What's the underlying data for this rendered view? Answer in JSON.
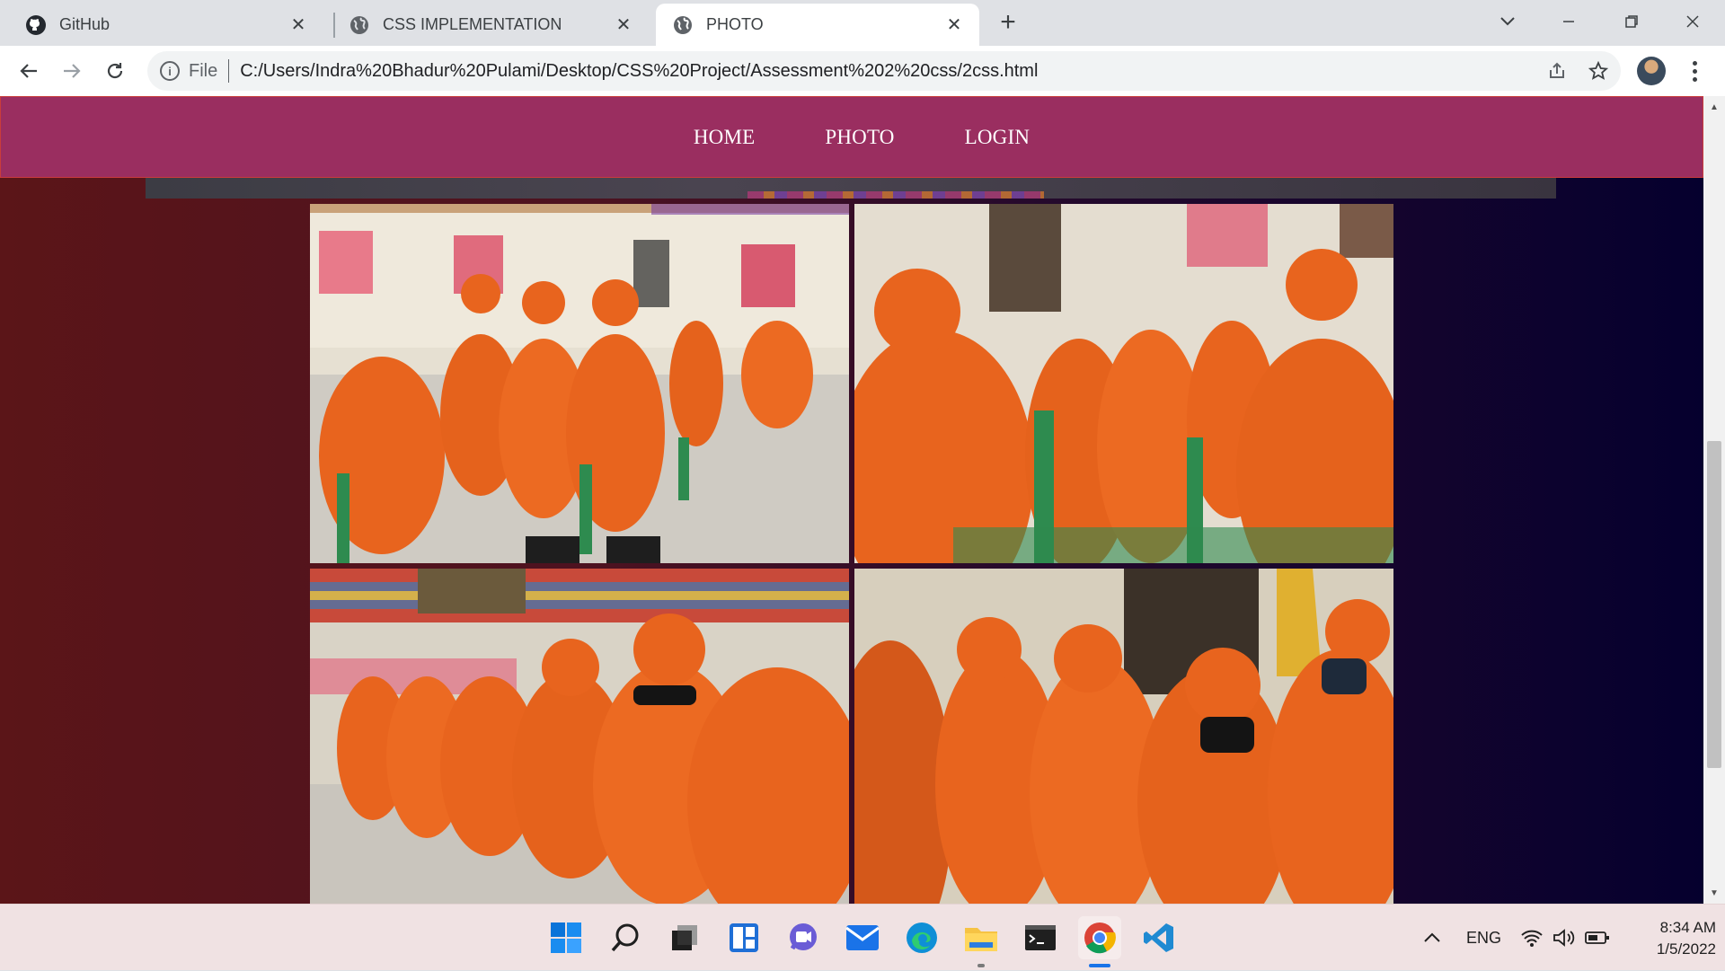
{
  "browser": {
    "tabs": [
      {
        "title": "GitHub",
        "icon": "github-icon",
        "active": false
      },
      {
        "title": "CSS IMPLEMENTATION",
        "icon": "globe-icon",
        "active": false
      },
      {
        "title": "PHOTO",
        "icon": "globe-icon",
        "active": true
      }
    ],
    "omnibox": {
      "scheme_label": "File",
      "url": "C:/Users/Indra%20Bhadur%20Pulami/Desktop/CSS%20Project/Assessment%202%20css/2css.html"
    }
  },
  "page": {
    "nav": [
      "HOME",
      "PHOTO",
      "LOGIN"
    ],
    "colors": {
      "nav_bg": "#9a2e60",
      "uniform": "#e8641e",
      "chair": "#2e8b4f"
    },
    "photos": [
      {
        "subject": "seated-trainees-hall-left"
      },
      {
        "subject": "seated-trainees-hall-right"
      },
      {
        "subject": "standing-row-salute"
      },
      {
        "subject": "standing-group-salute"
      }
    ]
  },
  "taskbar": {
    "apps": [
      "start-icon",
      "search-icon",
      "task-view-icon",
      "widgets-icon",
      "chat-icon",
      "mail-icon",
      "edge-icon",
      "file-explorer-icon",
      "terminal-icon",
      "chrome-icon",
      "vscode-icon"
    ],
    "tray_language": "ENG",
    "time": "8:34 AM",
    "date": "1/5/2022"
  }
}
